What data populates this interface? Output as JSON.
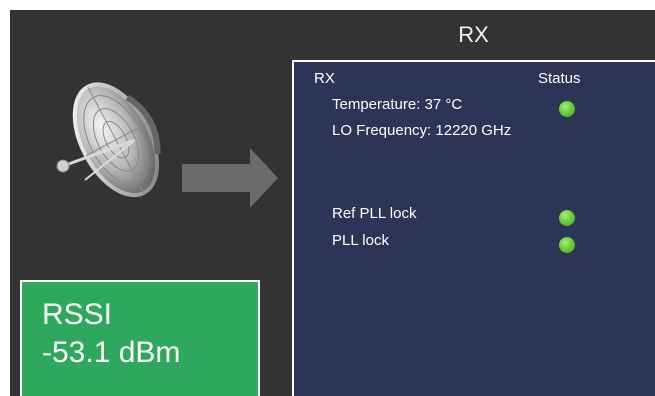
{
  "rx_header": {
    "title": "RX"
  },
  "rx_panel": {
    "section_label": "RX",
    "status_header": "Status",
    "temperature_label": "Temperature: 37 °C",
    "lo_frequency_label": "LO Frequency: 12220 GHz",
    "ref_pll_label": "Ref PLL lock",
    "pll_label": "PLL lock",
    "indicators": {
      "temperature": "ok",
      "ref_pll_lock": "ok",
      "pll_lock": "ok"
    }
  },
  "rssi": {
    "label": "RSSI",
    "value": "-53.1 dBm"
  },
  "colors": {
    "background": "#333333",
    "panel": "#2c3555",
    "rssi_box": "#2ea85c",
    "led_ok": "#6ccf3c"
  },
  "icons": {
    "antenna": "satellite-dish-icon",
    "flow": "right-arrow-icon"
  }
}
